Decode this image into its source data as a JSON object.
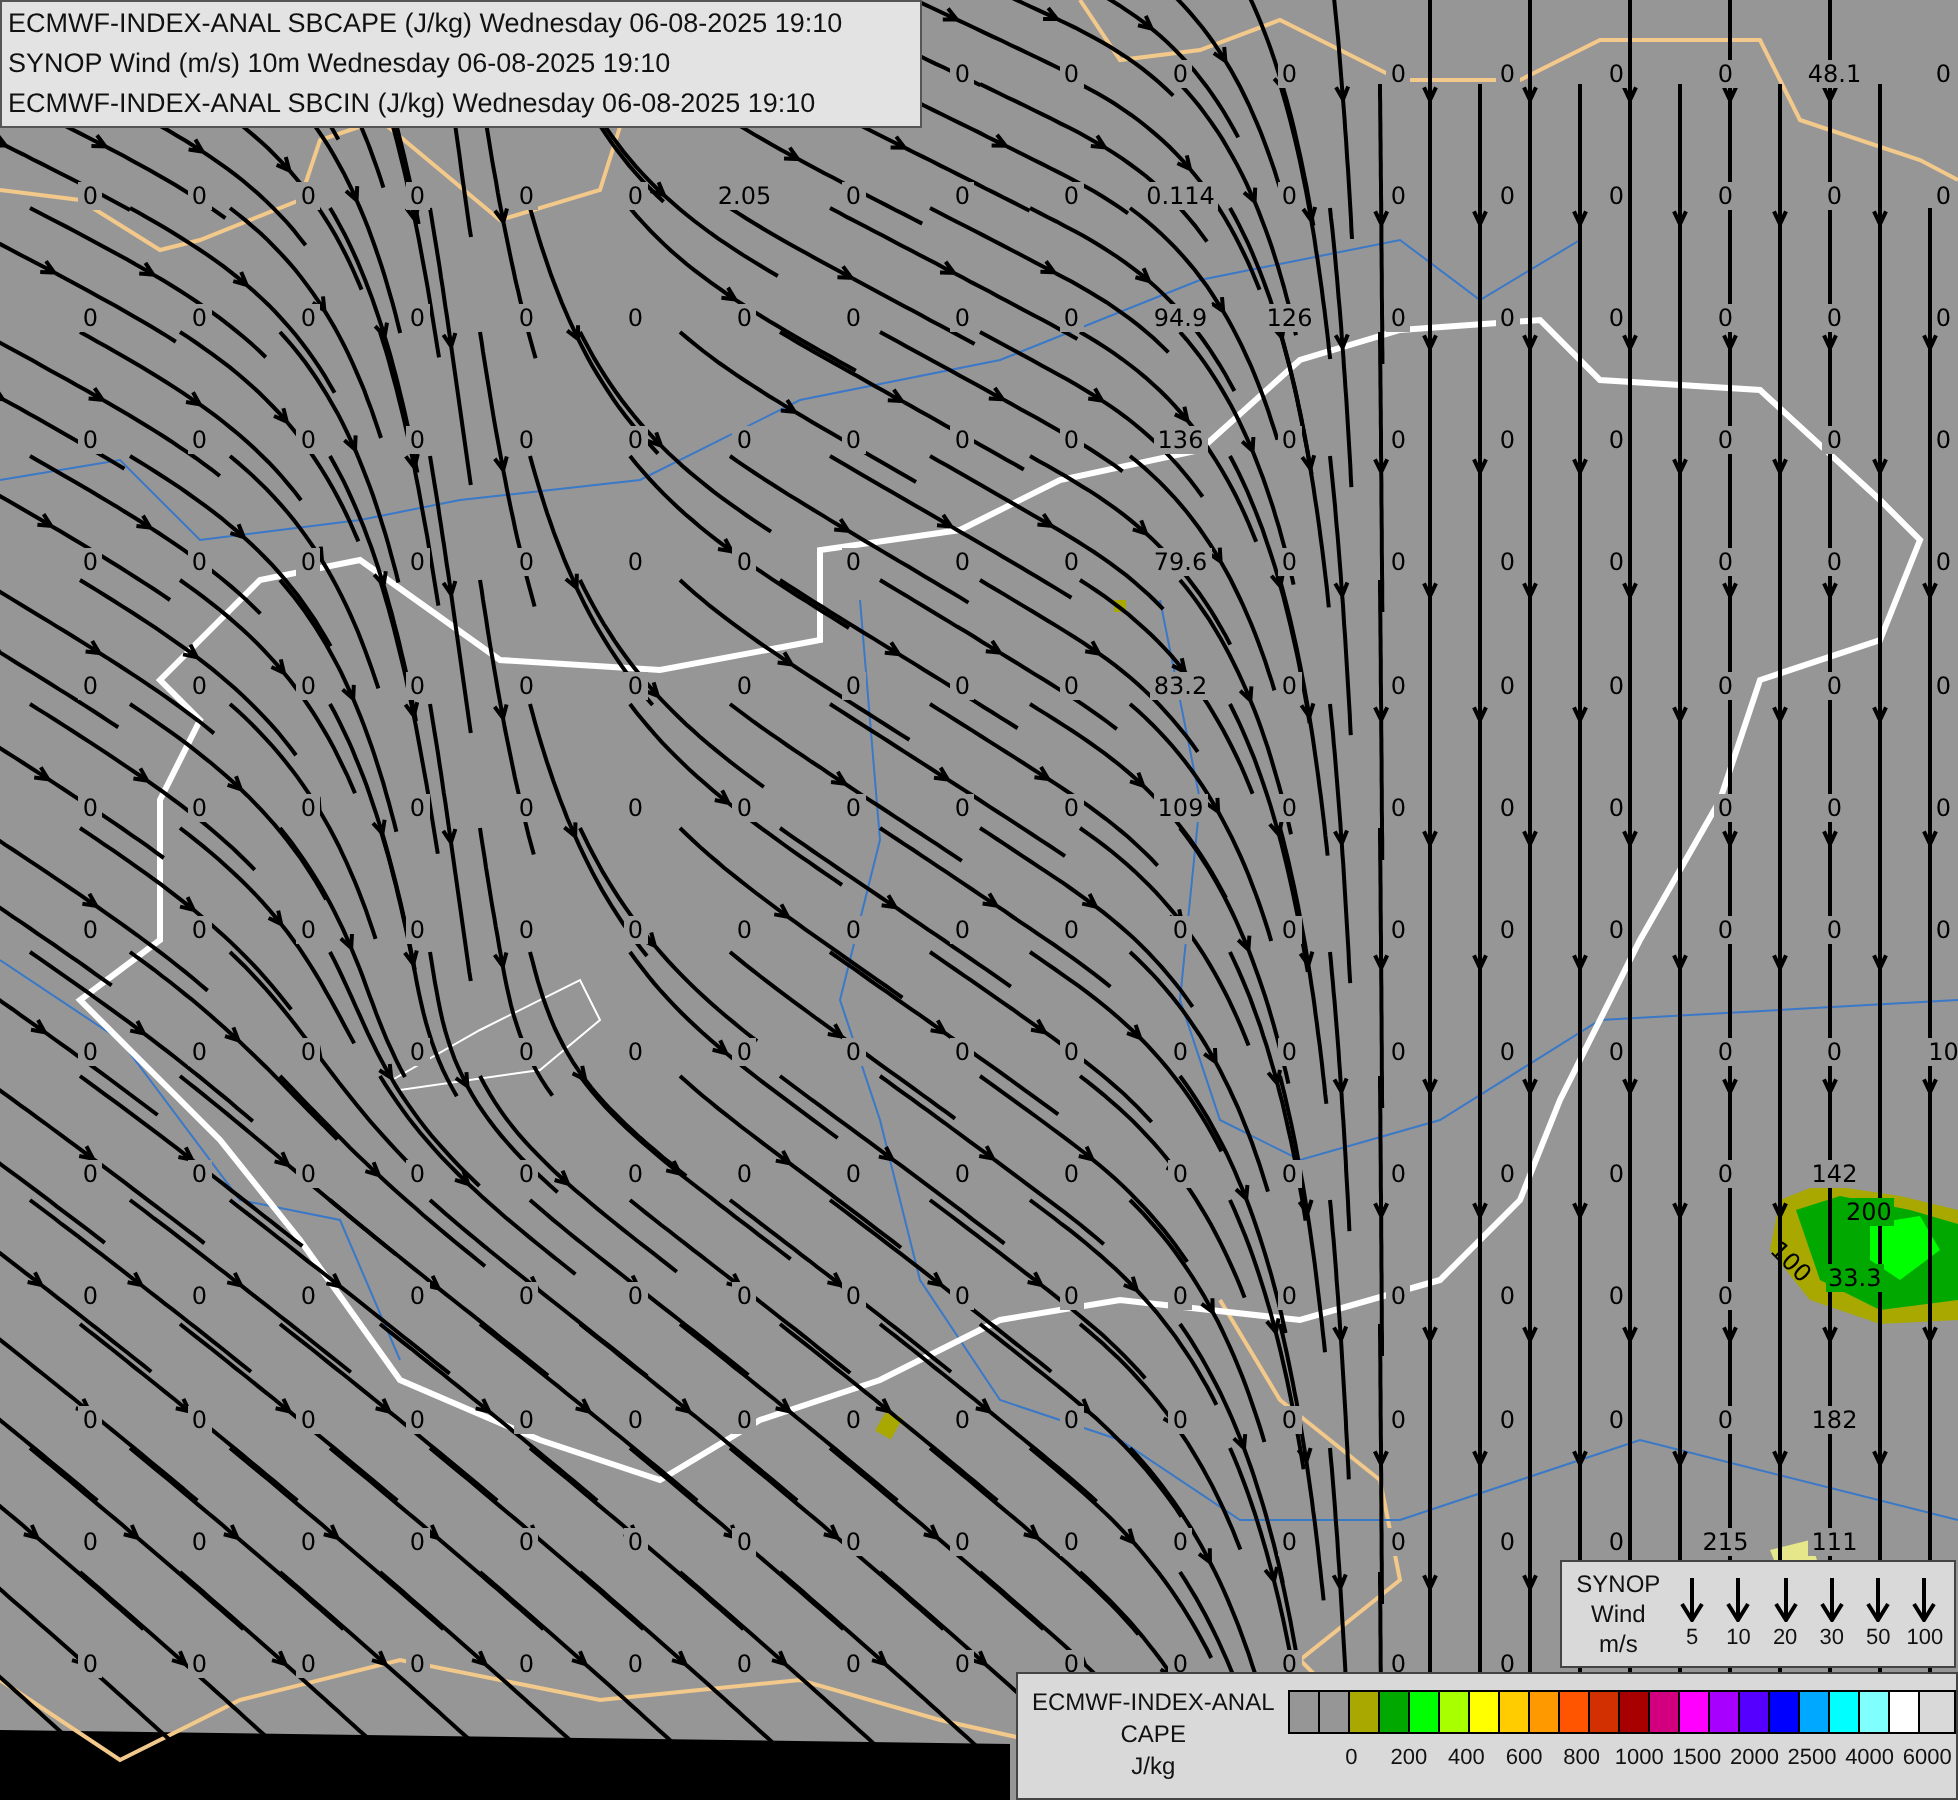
{
  "header": {
    "lines": [
      "ECMWF-INDEX-ANAL SBCAPE (J/kg) Wednesday 06-08-2025 19:10",
      "SYNOP Wind (m/s) 10m Wednesday 06-08-2025 19:10",
      "ECMWF-INDEX-ANAL SBCIN (J/kg) Wednesday 06-08-2025 19:10"
    ]
  },
  "cape_values": {
    "rows": [
      [
        null,
        null,
        null,
        null,
        null,
        null,
        null,
        null,
        "0",
        "0",
        "0",
        "0",
        "0",
        "0",
        "0",
        "0",
        "48.1",
        "0"
      ],
      [
        "0",
        "0",
        "0",
        "0",
        "0",
        "0",
        "2.05",
        "0",
        "0",
        "0",
        "0.114",
        "0",
        "0",
        "0",
        "0",
        "0",
        "0",
        "0"
      ],
      [
        "0",
        "0",
        "0",
        "0",
        "0",
        "0",
        "0",
        "0",
        "0",
        "0",
        "94.9",
        "126",
        "0",
        "0",
        "0",
        "0",
        "0",
        "0"
      ],
      [
        "0",
        "0",
        "0",
        "0",
        "0",
        "0",
        "0",
        "0",
        "0",
        "0",
        "136",
        "0",
        "0",
        "0",
        "0",
        "0",
        "0",
        "0"
      ],
      [
        "0",
        "0",
        "0",
        "0",
        "0",
        "0",
        "0",
        "0",
        "0",
        "0",
        "79.6",
        "0",
        "0",
        "0",
        "0",
        "0",
        "0",
        "0"
      ],
      [
        "0",
        "0",
        "0",
        "0",
        "0",
        "0",
        "0",
        "0",
        "0",
        "0",
        "83.2",
        "0",
        "0",
        "0",
        "0",
        "0",
        "0",
        "0"
      ],
      [
        "0",
        "0",
        "0",
        "0",
        "0",
        "0",
        "0",
        "0",
        "0",
        "0",
        "109",
        "0",
        "0",
        "0",
        "0",
        "0",
        "0",
        "0"
      ],
      [
        "0",
        "0",
        "0",
        "0",
        "0",
        "0",
        "0",
        "0",
        "0",
        "0",
        "0",
        "0",
        "0",
        "0",
        "0",
        "0",
        "0",
        "0"
      ],
      [
        "0",
        "0",
        "0",
        "0",
        "0",
        "0",
        "0",
        "0",
        "0",
        "0",
        "0",
        "0",
        "0",
        "0",
        "0",
        "0",
        "0",
        "10"
      ],
      [
        "0",
        "0",
        "0",
        "0",
        "0",
        "0",
        "0",
        "0",
        "0",
        "0",
        "0",
        "0",
        "0",
        "0",
        "0",
        "0",
        "142",
        null
      ],
      [
        "0",
        "0",
        "0",
        "0",
        "0",
        "0",
        "0",
        "0",
        "0",
        "0",
        "0",
        "0",
        "0",
        "0",
        "0",
        "0",
        null,
        null
      ],
      [
        "0",
        "0",
        "0",
        "0",
        "0",
        "0",
        "0",
        "0",
        "0",
        "0",
        "0",
        "0",
        "0",
        "0",
        "0",
        "0",
        "182",
        null
      ],
      [
        "0",
        "0",
        "0",
        "0",
        "0",
        "0",
        "0",
        "0",
        "0",
        "0",
        "0",
        "0",
        "0",
        "0",
        "0",
        "215",
        "111",
        null
      ],
      [
        "0",
        "0",
        "0",
        "0",
        "0",
        "0",
        "0",
        "0",
        "0",
        "0",
        "0",
        "0",
        "0",
        "0",
        null,
        null,
        null,
        null
      ]
    ]
  },
  "cape_area": {
    "labels": [
      "200",
      "100",
      "33.3"
    ]
  },
  "synop_legend": {
    "lines": [
      "SYNOP",
      "Wind",
      "m/s"
    ],
    "speeds": [
      "5",
      "10",
      "20",
      "30",
      "50",
      "100"
    ]
  },
  "cape_legend": {
    "lines": [
      "ECMWF-INDEX-ANAL",
      "CAPE",
      "J/kg"
    ],
    "swatches": [
      {
        "color": "#969696"
      },
      {
        "color": "#969696"
      },
      {
        "color": "#a8a800"
      },
      {
        "color": "#00a800"
      },
      {
        "color": "#00ff00"
      },
      {
        "color": "#a8ff00"
      },
      {
        "color": "#ffff00"
      },
      {
        "color": "#ffcc00"
      },
      {
        "color": "#ff9900"
      },
      {
        "color": "#ff5500"
      },
      {
        "color": "#d23000"
      },
      {
        "color": "#a80000"
      },
      {
        "color": "#d2007f"
      },
      {
        "color": "#ff00ff"
      },
      {
        "color": "#a800ff"
      },
      {
        "color": "#5500ff"
      },
      {
        "color": "#0000ff"
      },
      {
        "color": "#00a8ff"
      },
      {
        "color": "#00ffff"
      },
      {
        "color": "#80ffff"
      },
      {
        "color": "#ffffff"
      }
    ],
    "ticks": [
      "0",
      "200",
      "400",
      "600",
      "800",
      "1000",
      "1500",
      "2000",
      "2500",
      "4000",
      "6000"
    ]
  }
}
